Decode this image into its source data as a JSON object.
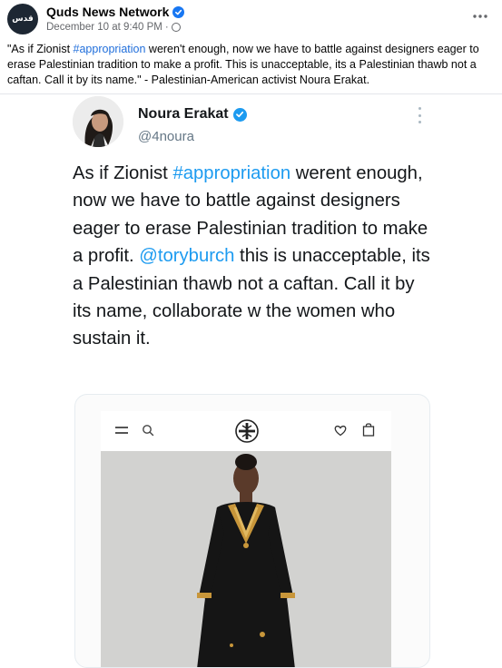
{
  "post": {
    "page_name": "Quds News Network",
    "avatar_text": "قدس",
    "timestamp": "December 10 at 9:40 PM",
    "separator": "·",
    "text_before_tag": "\"As if Zionist ",
    "hashtag": "#appropriation",
    "text_after_tag": " weren't enough, now we have to battle against designers eager to erase Palestinian tradition to make a profit. This is unacceptable, its a Palestinian thawb not a caftan. Call it by its name.\" - Palestinian-American activist Noura Erakat."
  },
  "tweet": {
    "name": "Noura Erakat",
    "handle": "@4noura",
    "text_1": "As if Zionist ",
    "hashtag": "#appropriation",
    "text_2": " werent enough, now we have to battle against designers eager to erase Palestinian tradition to make a profit. ",
    "mention": "@toryburch",
    "text_3": " this is unacceptable, its a Palestinian thawb not a caftan. Call it by its name, collaborate w the women who sustain it."
  },
  "icons": {
    "verified": "verified-badge-icon",
    "globe": "globe-icon",
    "more": "more-options-icon",
    "menu": "menu-icon",
    "search": "search-icon",
    "logo": "tory-burch-logo-icon",
    "heart": "heart-icon",
    "bag": "shopping-bag-icon"
  },
  "colors": {
    "facebook_link": "#216fdb",
    "twitter_link": "#1d9bf0",
    "verified_fb": "#1877f2",
    "verified_tw": "#1d9bf0",
    "meta_text": "#65676b"
  }
}
